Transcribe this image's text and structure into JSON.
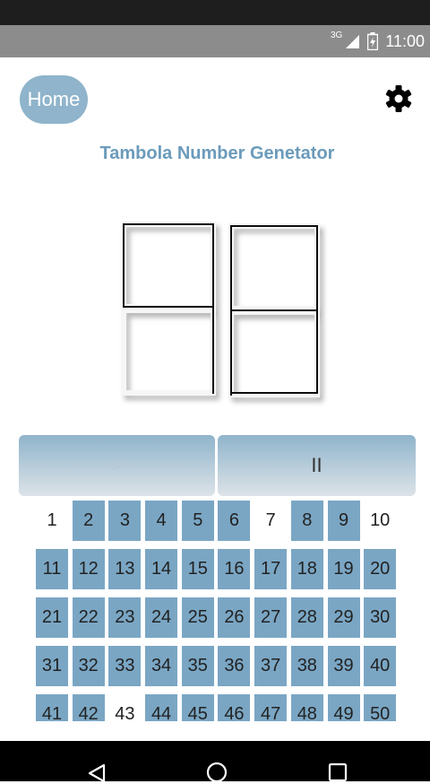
{
  "status_bar": {
    "network": "3G",
    "time": "11:00"
  },
  "header": {
    "home_label": "Home",
    "settings_icon": "gear-icon"
  },
  "title": "Tambola Number Genetator",
  "controls": {
    "start_label": ">",
    "pause_label": "II"
  },
  "colors": {
    "accent": "#7aa6c4",
    "title": "#6b9bbb",
    "button": "#8fb4cb"
  },
  "board": {
    "numbers": [
      1,
      2,
      3,
      4,
      5,
      6,
      7,
      8,
      9,
      10,
      11,
      12,
      13,
      14,
      15,
      16,
      17,
      18,
      19,
      20,
      21,
      22,
      23,
      24,
      25,
      26,
      27,
      28,
      29,
      30,
      31,
      32,
      33,
      34,
      35,
      36,
      37,
      38,
      39,
      40,
      41,
      42,
      43,
      44,
      45,
      46,
      47,
      48,
      49,
      50
    ],
    "called": [
      2,
      3,
      4,
      5,
      6,
      8,
      9,
      11,
      12,
      13,
      14,
      15,
      16,
      17,
      18,
      19,
      20,
      21,
      22,
      23,
      24,
      25,
      26,
      27,
      28,
      29,
      30,
      31,
      32,
      33,
      34,
      35,
      36,
      37,
      38,
      39,
      40,
      41,
      42,
      44,
      45,
      46,
      47,
      48,
      49,
      50
    ]
  },
  "nav": {
    "back": "back-icon",
    "home": "home-icon",
    "recents": "recents-icon"
  }
}
